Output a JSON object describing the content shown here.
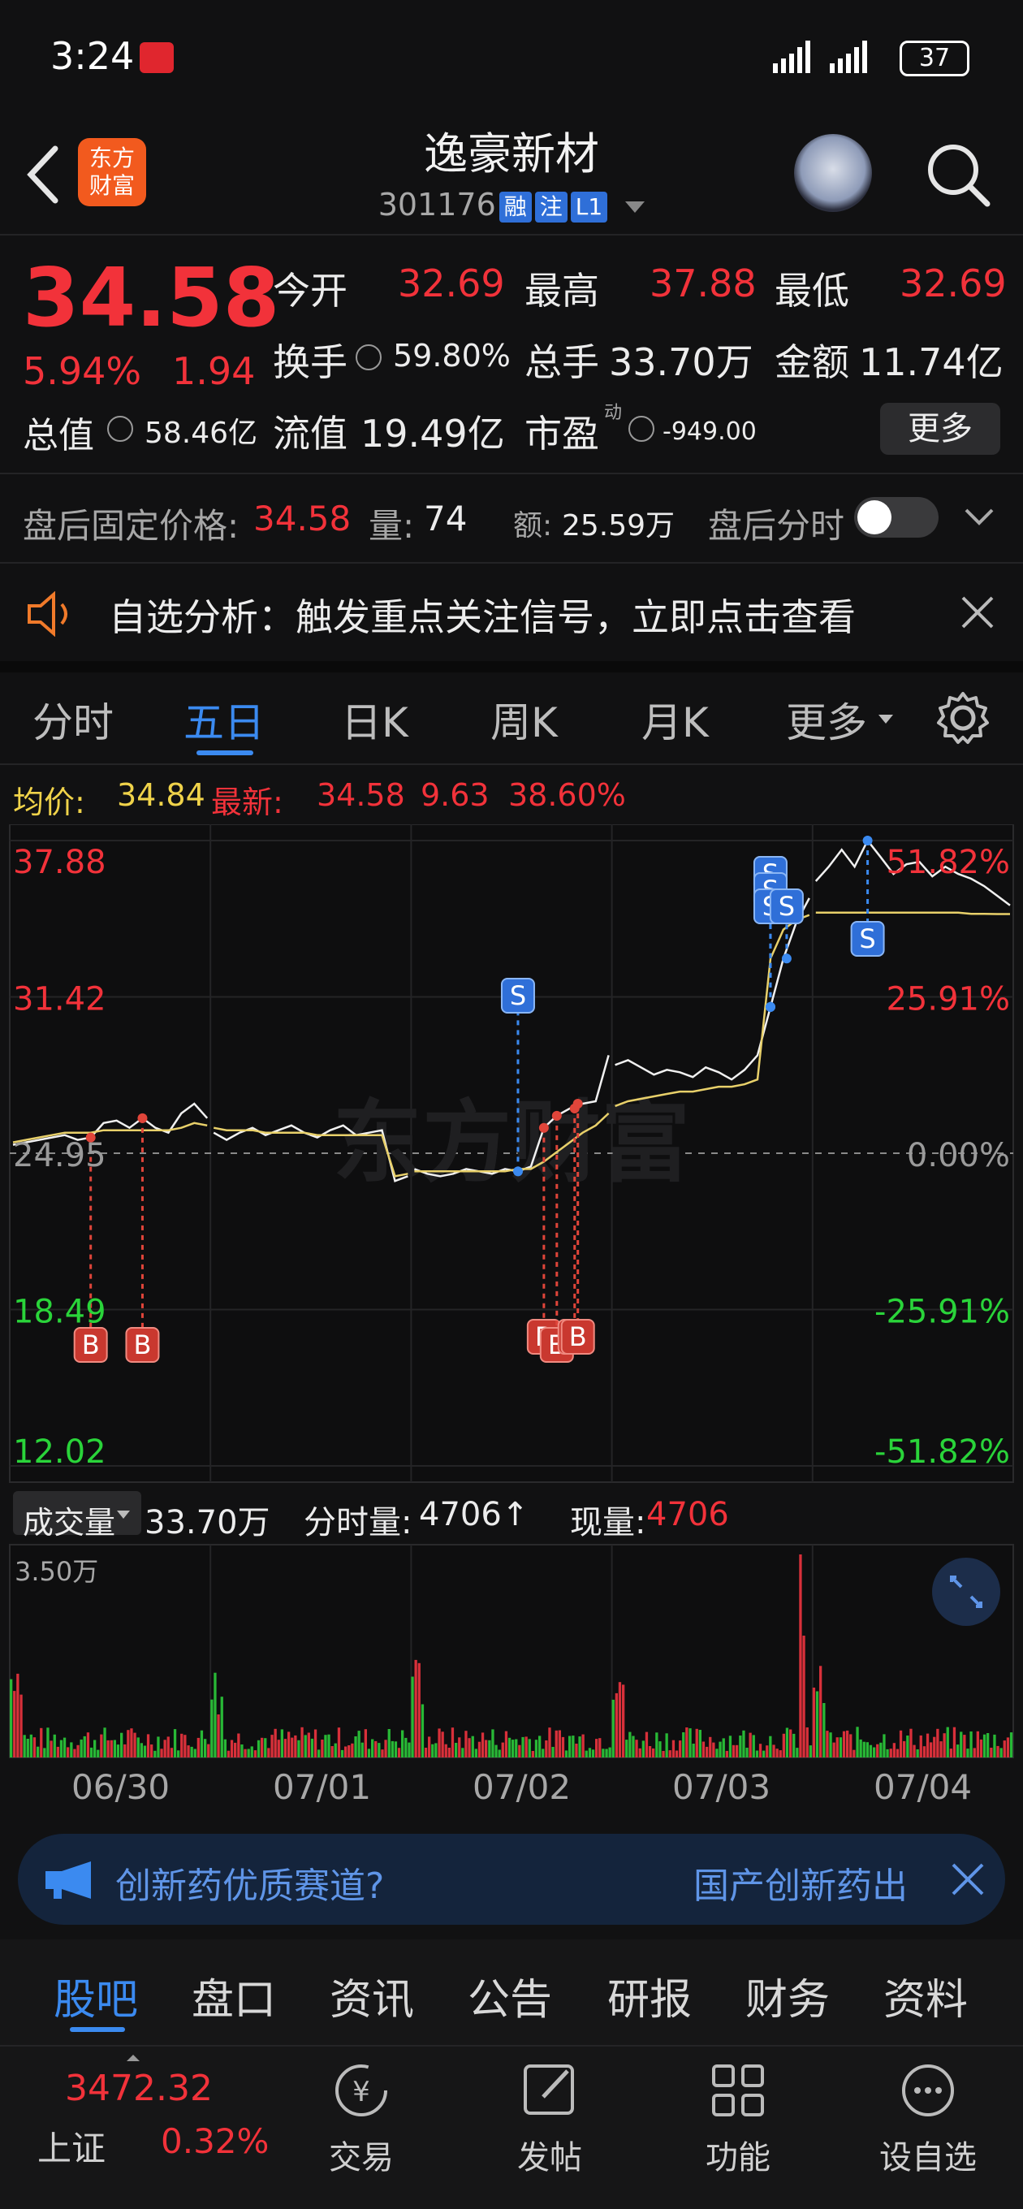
{
  "status_bar": {
    "time": "3:24",
    "battery": "37"
  },
  "header": {
    "title": "逸豪新材",
    "code": "301176",
    "tags": [
      "融",
      "注",
      "L1"
    ]
  },
  "quote": {
    "price": "34.58",
    "change_pct": "5.94%",
    "change": "1.94",
    "open_label": "今开",
    "open": "32.69",
    "high_label": "最高",
    "high": "37.88",
    "low_label": "最低",
    "low": "32.69",
    "turnover_label": "换手",
    "turnover": "59.80%",
    "volume_label": "总手",
    "volume": "33.70万",
    "amount_label": "金额",
    "amount": "11.74亿",
    "mcap_label": "总值",
    "mcap": "58.46亿",
    "float_label": "流值",
    "float": "19.49亿",
    "pe_label": "市盈",
    "pe_sup": "动",
    "pe": "-949.00",
    "more_btn": "更多"
  },
  "after_hours": {
    "price_label": "盘后固定价格:",
    "price": "34.58",
    "vol_label": "量:",
    "vol": "74",
    "amt_label": "额:",
    "amt": "25.59万",
    "toggle_label": "盘后分时",
    "toggle_on": false
  },
  "banner": {
    "text": "自选分析：触发重点关注信号，立即点击查看"
  },
  "chart_tabs": [
    "分时",
    "五日",
    "日K",
    "周K",
    "月K",
    "更多"
  ],
  "active_tab": "五日",
  "chart_header": {
    "avg_label": "均价:",
    "avg": "34.84",
    "latest_label": "最新:",
    "latest": "34.58",
    "chg": "9.63",
    "pct": "38.60%"
  },
  "colors": {
    "up": "#f2323a",
    "down": "#2ad43a",
    "accent": "#3b8af0",
    "avg_line": "#e8d06a"
  },
  "chart_data": {
    "type": "line",
    "y_left": [
      "37.88",
      "31.42",
      "24.95",
      "18.49",
      "12.02"
    ],
    "y_right": [
      "51.82%",
      "25.91%",
      "0.00%",
      "-25.91%",
      "-51.82%"
    ],
    "prev_close": 24.95,
    "ylim": [
      12.02,
      37.88
    ],
    "dates": [
      "06/30",
      "07/01",
      "07/02",
      "07/03",
      "07/04"
    ],
    "price": [
      25.3,
      25.4,
      25.5,
      25.6,
      25.7,
      25.5,
      25.6,
      26.2,
      26.3,
      26.0,
      26.4,
      26.0,
      25.8,
      26.6,
      27.0,
      26.4,
      25.8,
      25.5,
      25.8,
      26.0,
      25.7,
      25.9,
      26.1,
      25.8,
      25.6,
      25.9,
      26.1,
      25.7,
      25.8,
      25.9,
      23.8,
      24.0,
      24.3,
      24.1,
      24.0,
      24.1,
      24.3,
      24.2,
      24.1,
      24.3,
      24.2,
      24.4,
      26.0,
      26.5,
      26.8,
      27.0,
      27.1,
      29.0,
      28.6,
      28.8,
      28.5,
      28.2,
      28.4,
      28.3,
      28.1,
      28.5,
      28.3,
      28.0,
      28.4,
      29.0,
      31.0,
      33.0,
      34.5,
      35.5,
      36.2,
      36.8,
      37.5,
      36.8,
      37.88,
      37.2,
      36.5,
      36.9,
      37.0,
      36.4,
      36.8,
      36.5,
      36.3,
      36.0,
      35.6,
      35.2
    ],
    "avg": [
      25.4,
      25.5,
      25.6,
      25.7,
      25.8,
      25.8,
      25.8,
      25.9,
      25.9,
      25.9,
      25.9,
      25.9,
      25.9,
      26.0,
      26.2,
      26.1,
      26.0,
      25.9,
      25.9,
      25.9,
      25.8,
      25.8,
      25.8,
      25.8,
      25.7,
      25.7,
      25.7,
      25.7,
      25.7,
      25.7,
      24.0,
      24.1,
      24.2,
      24.2,
      24.2,
      24.2,
      24.2,
      24.2,
      24.2,
      24.2,
      24.3,
      24.3,
      24.6,
      25.0,
      25.4,
      25.8,
      26.1,
      26.6,
      26.9,
      27.1,
      27.2,
      27.3,
      27.4,
      27.5,
      27.5,
      27.6,
      27.7,
      27.7,
      27.8,
      28.0,
      33.0,
      34.2,
      34.6,
      34.8,
      34.9,
      34.9,
      34.9,
      34.9,
      34.9,
      34.9,
      34.9,
      34.9,
      34.9,
      34.9,
      34.9,
      34.9,
      34.85,
      34.85,
      34.84,
      34.84
    ],
    "markers_buy": [
      "B",
      "B",
      "B",
      "B",
      "B",
      "B"
    ],
    "markers_sell": [
      "S",
      "S",
      "S",
      "S",
      "S",
      "S"
    ]
  },
  "volume_section": {
    "selector": "成交量",
    "total": "33.70万",
    "tick_label": "分时量:",
    "tick": "4706↑",
    "now_label": "现量:",
    "now": "4706",
    "ymax": "3.50万"
  },
  "ad_banner": {
    "text": "创新药优质赛道?",
    "link": "国产创新药出"
  },
  "bottom_tabs": [
    "股吧",
    "盘口",
    "资讯",
    "公告",
    "研报",
    "财务",
    "资料"
  ],
  "active_bottom_tab": "股吧",
  "toolbar": {
    "index_value": "3472.32",
    "index_name": "上证",
    "index_pct": "0.32%",
    "items": [
      "交易",
      "发帖",
      "功能",
      "设自选"
    ]
  }
}
